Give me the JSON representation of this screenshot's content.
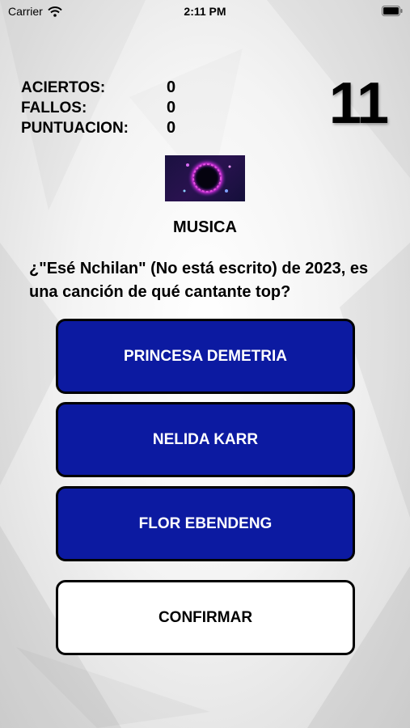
{
  "status_bar": {
    "carrier": "Carrier",
    "time": "2:11 PM"
  },
  "stats": [
    {
      "label": "ACIERTOS:",
      "value": "0"
    },
    {
      "label": "FALLOS:",
      "value": "0"
    },
    {
      "label": "PUNTUACION:",
      "value": "0"
    }
  ],
  "timer": "11",
  "category": {
    "name": "MUSICA",
    "image": "music-category-image"
  },
  "question": "¿\"Esé Nchilan\" (No está escrito) de 2023, es una canción de qué cantante top?",
  "answers": [
    "PRINCESA DEMETRIA",
    "NELIDA KARR",
    "FLOR EBENDENG"
  ],
  "confirm_label": "CONFIRMAR",
  "colors": {
    "answer_bg": "#0c1aa1",
    "answer_text": "#ffffff",
    "confirm_bg": "#ffffff",
    "border": "#000000"
  }
}
